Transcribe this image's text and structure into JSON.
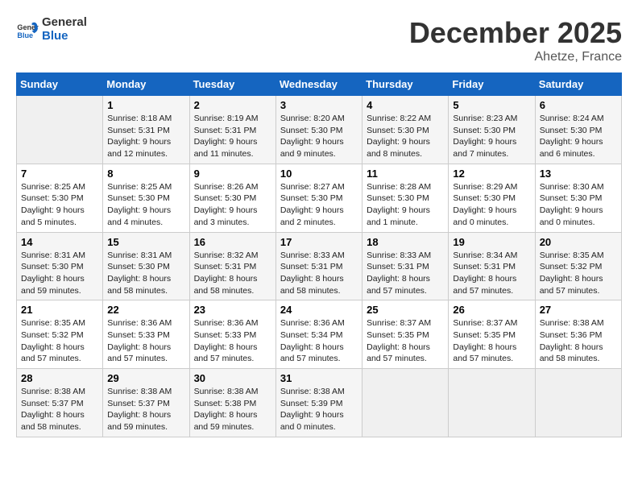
{
  "header": {
    "logo_line1": "General",
    "logo_line2": "Blue",
    "month": "December 2025",
    "location": "Ahetze, France"
  },
  "days_of_week": [
    "Sunday",
    "Monday",
    "Tuesday",
    "Wednesday",
    "Thursday",
    "Friday",
    "Saturday"
  ],
  "weeks": [
    [
      {
        "day": "",
        "empty": true
      },
      {
        "day": "1",
        "sunrise": "Sunrise: 8:18 AM",
        "sunset": "Sunset: 5:31 PM",
        "daylight": "Daylight: 9 hours and 12 minutes."
      },
      {
        "day": "2",
        "sunrise": "Sunrise: 8:19 AM",
        "sunset": "Sunset: 5:31 PM",
        "daylight": "Daylight: 9 hours and 11 minutes."
      },
      {
        "day": "3",
        "sunrise": "Sunrise: 8:20 AM",
        "sunset": "Sunset: 5:30 PM",
        "daylight": "Daylight: 9 hours and 9 minutes."
      },
      {
        "day": "4",
        "sunrise": "Sunrise: 8:22 AM",
        "sunset": "Sunset: 5:30 PM",
        "daylight": "Daylight: 9 hours and 8 minutes."
      },
      {
        "day": "5",
        "sunrise": "Sunrise: 8:23 AM",
        "sunset": "Sunset: 5:30 PM",
        "daylight": "Daylight: 9 hours and 7 minutes."
      },
      {
        "day": "6",
        "sunrise": "Sunrise: 8:24 AM",
        "sunset": "Sunset: 5:30 PM",
        "daylight": "Daylight: 9 hours and 6 minutes."
      }
    ],
    [
      {
        "day": "7",
        "sunrise": "Sunrise: 8:25 AM",
        "sunset": "Sunset: 5:30 PM",
        "daylight": "Daylight: 9 hours and 5 minutes."
      },
      {
        "day": "8",
        "sunrise": "Sunrise: 8:25 AM",
        "sunset": "Sunset: 5:30 PM",
        "daylight": "Daylight: 9 hours and 4 minutes."
      },
      {
        "day": "9",
        "sunrise": "Sunrise: 8:26 AM",
        "sunset": "Sunset: 5:30 PM",
        "daylight": "Daylight: 9 hours and 3 minutes."
      },
      {
        "day": "10",
        "sunrise": "Sunrise: 8:27 AM",
        "sunset": "Sunset: 5:30 PM",
        "daylight": "Daylight: 9 hours and 2 minutes."
      },
      {
        "day": "11",
        "sunrise": "Sunrise: 8:28 AM",
        "sunset": "Sunset: 5:30 PM",
        "daylight": "Daylight: 9 hours and 1 minute."
      },
      {
        "day": "12",
        "sunrise": "Sunrise: 8:29 AM",
        "sunset": "Sunset: 5:30 PM",
        "daylight": "Daylight: 9 hours and 0 minutes."
      },
      {
        "day": "13",
        "sunrise": "Sunrise: 8:30 AM",
        "sunset": "Sunset: 5:30 PM",
        "daylight": "Daylight: 9 hours and 0 minutes."
      }
    ],
    [
      {
        "day": "14",
        "sunrise": "Sunrise: 8:31 AM",
        "sunset": "Sunset: 5:30 PM",
        "daylight": "Daylight: 8 hours and 59 minutes."
      },
      {
        "day": "15",
        "sunrise": "Sunrise: 8:31 AM",
        "sunset": "Sunset: 5:30 PM",
        "daylight": "Daylight: 8 hours and 58 minutes."
      },
      {
        "day": "16",
        "sunrise": "Sunrise: 8:32 AM",
        "sunset": "Sunset: 5:31 PM",
        "daylight": "Daylight: 8 hours and 58 minutes."
      },
      {
        "day": "17",
        "sunrise": "Sunrise: 8:33 AM",
        "sunset": "Sunset: 5:31 PM",
        "daylight": "Daylight: 8 hours and 58 minutes."
      },
      {
        "day": "18",
        "sunrise": "Sunrise: 8:33 AM",
        "sunset": "Sunset: 5:31 PM",
        "daylight": "Daylight: 8 hours and 57 minutes."
      },
      {
        "day": "19",
        "sunrise": "Sunrise: 8:34 AM",
        "sunset": "Sunset: 5:31 PM",
        "daylight": "Daylight: 8 hours and 57 minutes."
      },
      {
        "day": "20",
        "sunrise": "Sunrise: 8:35 AM",
        "sunset": "Sunset: 5:32 PM",
        "daylight": "Daylight: 8 hours and 57 minutes."
      }
    ],
    [
      {
        "day": "21",
        "sunrise": "Sunrise: 8:35 AM",
        "sunset": "Sunset: 5:32 PM",
        "daylight": "Daylight: 8 hours and 57 minutes."
      },
      {
        "day": "22",
        "sunrise": "Sunrise: 8:36 AM",
        "sunset": "Sunset: 5:33 PM",
        "daylight": "Daylight: 8 hours and 57 minutes."
      },
      {
        "day": "23",
        "sunrise": "Sunrise: 8:36 AM",
        "sunset": "Sunset: 5:33 PM",
        "daylight": "Daylight: 8 hours and 57 minutes."
      },
      {
        "day": "24",
        "sunrise": "Sunrise: 8:36 AM",
        "sunset": "Sunset: 5:34 PM",
        "daylight": "Daylight: 8 hours and 57 minutes."
      },
      {
        "day": "25",
        "sunrise": "Sunrise: 8:37 AM",
        "sunset": "Sunset: 5:35 PM",
        "daylight": "Daylight: 8 hours and 57 minutes."
      },
      {
        "day": "26",
        "sunrise": "Sunrise: 8:37 AM",
        "sunset": "Sunset: 5:35 PM",
        "daylight": "Daylight: 8 hours and 57 minutes."
      },
      {
        "day": "27",
        "sunrise": "Sunrise: 8:38 AM",
        "sunset": "Sunset: 5:36 PM",
        "daylight": "Daylight: 8 hours and 58 minutes."
      }
    ],
    [
      {
        "day": "28",
        "sunrise": "Sunrise: 8:38 AM",
        "sunset": "Sunset: 5:37 PM",
        "daylight": "Daylight: 8 hours and 58 minutes."
      },
      {
        "day": "29",
        "sunrise": "Sunrise: 8:38 AM",
        "sunset": "Sunset: 5:37 PM",
        "daylight": "Daylight: 8 hours and 59 minutes."
      },
      {
        "day": "30",
        "sunrise": "Sunrise: 8:38 AM",
        "sunset": "Sunset: 5:38 PM",
        "daylight": "Daylight: 8 hours and 59 minutes."
      },
      {
        "day": "31",
        "sunrise": "Sunrise: 8:38 AM",
        "sunset": "Sunset: 5:39 PM",
        "daylight": "Daylight: 9 hours and 0 minutes."
      },
      {
        "day": "",
        "empty": true
      },
      {
        "day": "",
        "empty": true
      },
      {
        "day": "",
        "empty": true
      }
    ]
  ]
}
